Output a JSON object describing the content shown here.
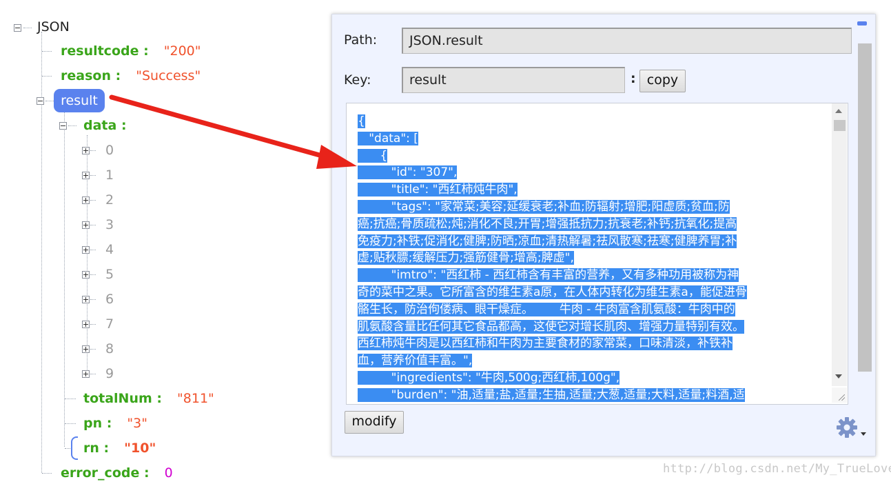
{
  "tree": {
    "root_label": "JSON",
    "resultcode": {
      "key": "resultcode :",
      "value": "\"200\""
    },
    "reason": {
      "key": "reason :",
      "value": "\"Success\""
    },
    "result": {
      "key": "result"
    },
    "data": {
      "key": "data :",
      "items": [
        "0",
        "1",
        "2",
        "3",
        "4",
        "5",
        "6",
        "7",
        "8",
        "9"
      ]
    },
    "totalNum": {
      "key": "totalNum :",
      "value": "\"811\""
    },
    "pn": {
      "key": "pn :",
      "value": "\"3\""
    },
    "rn": {
      "key": "rn :",
      "value": "\"10\""
    },
    "error_code": {
      "key": "error_code :",
      "value": "0"
    }
  },
  "panel": {
    "path_label": "Path:",
    "path_value": "JSON.result",
    "key_label": "Key:",
    "key_value": "result",
    "colon": ":",
    "copy_label": "copy",
    "modify_label": "modify",
    "gear_icon": "gear-icon",
    "code_lines": [
      "{",
      "   \"data\": [",
      "      {",
      "         \"id\": \"307\",",
      "         \"title\": \"西红柿炖牛肉\",",
      "         \"tags\": \"家常菜;美容;延缓衰老;补血;防辐射;增肥;阳虚质;贫血;防",
      "癌;抗癌;骨质疏松;炖;消化不良;开胃;增强抵抗力;抗衰老;补钙;抗氧化;提高",
      "免疫力;补铁;促消化;健脾;防晒;凉血;清热解暑;祛风散寒;祛寒;健脾养胃;补",
      "虚;贴秋膘;缓解压力;强筋健骨;增高;脾虚\",",
      "         \"imtro\": \"西红柿 - 西红柿含有丰富的营养，又有多种功用被称为神",
      "奇的菜中之果。它所富含的维生素a原，在人体内转化为维生素a，能促进骨",
      "骼生长，防治佝偻病、眼干燥症。       牛肉 - 牛肉富含肌氨酸：牛肉中的",
      "肌氨酸含量比任何其它食品都高，这使它对增长肌肉、增强力量特别有效。",
      "西红柿炖牛肉是以西红柿和牛肉为主要食材的家常菜，口味清淡，补铁补",
      "血，营养价值丰富。\",",
      "         \"ingredients\": \"牛肉,500g;西红柿,100g\",",
      "         \"burden\": \"油,适量;盐,适量;生抽,适量;大葱,适量;大料,适量;料酒,适"
    ]
  },
  "watermark": "http://blog.csdn.net/My_TrueLove",
  "colors": {
    "accent": "#5a82ee",
    "key": "#3aa51a",
    "value": "#f0522c",
    "selection": "#3b8df2",
    "arrow": "#e8231a"
  }
}
